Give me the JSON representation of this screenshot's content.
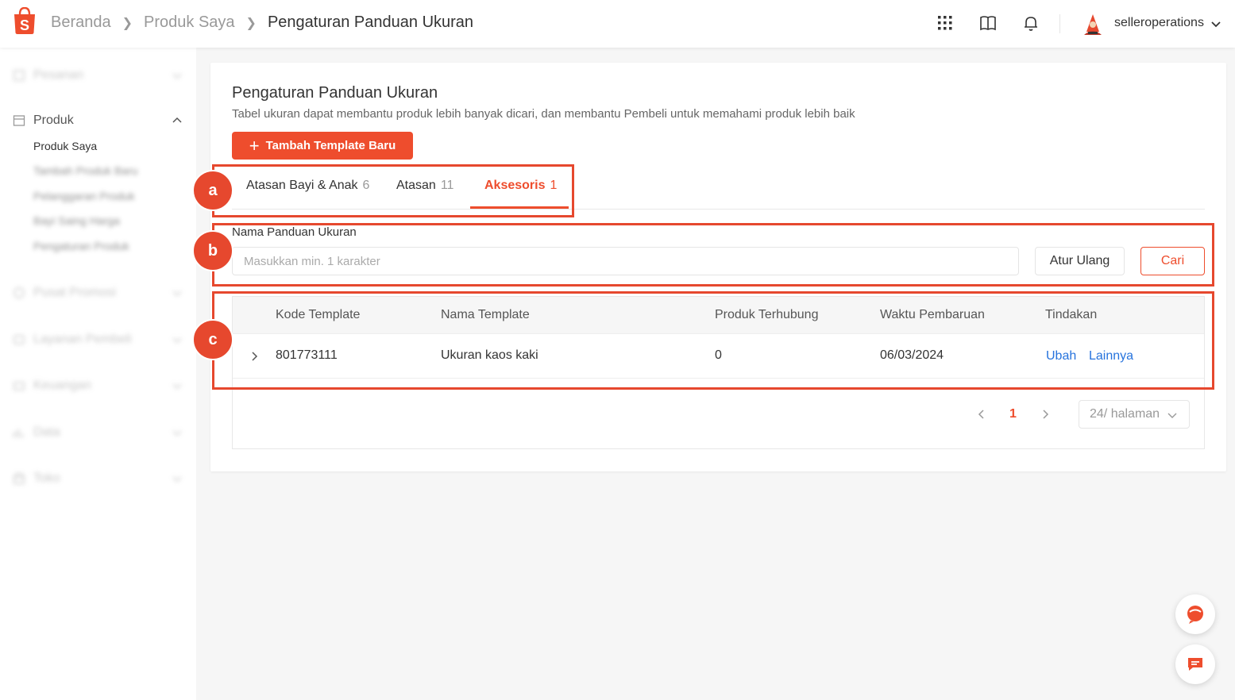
{
  "header": {
    "breadcrumb": [
      "Beranda",
      "Produk Saya",
      "Pengaturan Panduan Ukuran"
    ],
    "username": "selleroperations",
    "icons": [
      "apps-grid-icon",
      "book-icon",
      "bell-icon"
    ]
  },
  "sidebar": {
    "groups": [
      {
        "label": "Pesanan",
        "icon": "order-icon",
        "blurred": true
      },
      {
        "label": "Produk",
        "icon": "product-icon",
        "blurred": false
      },
      {
        "label": "Pusat Promosi",
        "icon": "promo-icon",
        "blurred": true
      },
      {
        "label": "Layanan Pembeli",
        "icon": "service-icon",
        "blurred": true
      },
      {
        "label": "Keuangan",
        "icon": "finance-icon",
        "blurred": true
      },
      {
        "label": "Data",
        "icon": "data-icon",
        "blurred": true
      },
      {
        "label": "Toko",
        "icon": "shop-icon",
        "blurred": true
      }
    ],
    "produk_items": [
      {
        "label": "Produk Saya",
        "blurred": false
      },
      {
        "label": "Tambah Produk Baru",
        "blurred": true
      },
      {
        "label": "Pelanggaran Produk",
        "blurred": true
      },
      {
        "label": "Bayi Saing Harga",
        "blurred": true
      },
      {
        "label": "Pengaturan Produk",
        "blurred": true
      }
    ]
  },
  "main": {
    "title": "Pengaturan Panduan Ukuran",
    "description": "Tabel ukuran dapat membantu produk lebih banyak dicari, dan membantu Pembeli untuk memahami produk lebih baik",
    "add_button": "Tambah Template Baru",
    "tabs": [
      {
        "label": "Atasan Bayi & Anak",
        "count": "6",
        "active": false
      },
      {
        "label": "Atasan",
        "count": "11",
        "active": false
      },
      {
        "label": "Aksesoris",
        "count": "1",
        "active": true
      }
    ],
    "filter": {
      "label": "Nama Panduan Ukuran",
      "placeholder": "Masukkan min. 1 karakter",
      "value": "",
      "reset_button": "Atur Ulang",
      "search_button": "Cari"
    },
    "table": {
      "columns": [
        "Kode Template",
        "Nama Template",
        "Produk Terhubung",
        "Waktu Pembaruan",
        "Tindakan"
      ],
      "rows": [
        {
          "code": "801773111",
          "name": "Ukuran kaos kaki",
          "linked": "0",
          "updated": "06/03/2024",
          "actions": [
            "Ubah",
            "Lainnya"
          ]
        }
      ]
    },
    "pagination": {
      "current_page": "1",
      "page_size": "24/ halaman"
    }
  },
  "annotations": {
    "labels": [
      "a",
      "b",
      "c"
    ],
    "color": "#e6482e"
  },
  "colors": {
    "brand": "#ee4d2d",
    "link": "#2673dd"
  }
}
